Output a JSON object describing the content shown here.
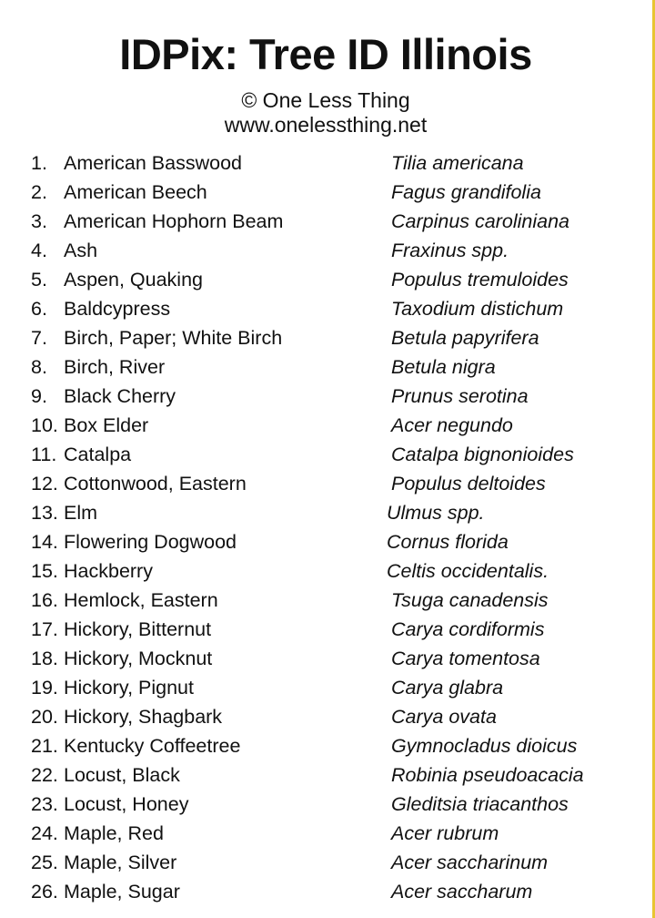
{
  "header": {
    "title": "IDPix: Tree ID Illinois",
    "copyright": "© One Less Thing",
    "website": "www.onelessthing.net"
  },
  "colors": {
    "accent_line": "#e8c532",
    "text": "#111111",
    "background": "#ffffff"
  },
  "trees": [
    {
      "num": "1.",
      "common": "American Basswood",
      "scientific": "Tilia americana"
    },
    {
      "num": "2.",
      "common": "American Beech",
      "scientific": "Fagus grandifolia"
    },
    {
      "num": "3.",
      "common": "American Hophorn Beam",
      "scientific": "Carpinus caroliniana"
    },
    {
      "num": "4.",
      "common": "Ash",
      "scientific": "Fraxinus spp."
    },
    {
      "num": "5.",
      "common": "Aspen, Quaking",
      "scientific": "Populus tremuloides"
    },
    {
      "num": "6.",
      "common": "Baldcypress",
      "scientific": "Taxodium distichum"
    },
    {
      "num": "7.",
      "common": "Birch, Paper; White Birch",
      "scientific": "Betula papyrifera"
    },
    {
      "num": "8.",
      "common": "Birch, River",
      "scientific": "Betula nigra"
    },
    {
      "num": "9.",
      "common": "Black Cherry",
      "scientific": "Prunus serotina"
    },
    {
      "num": "10.",
      "common": "Box Elder",
      "scientific": "Acer negundo"
    },
    {
      "num": "11.",
      "common": "Catalpa",
      "scientific": "Catalpa bignonioides"
    },
    {
      "num": "12.",
      "common": "Cottonwood, Eastern",
      "scientific": "Populus deltoides"
    },
    {
      "num": "13.",
      "common": "Elm",
      "scientific": "Ulmus spp."
    },
    {
      "num": "14.",
      "common": "Flowering Dogwood",
      "scientific": "Cornus florida"
    },
    {
      "num": "15.",
      "common": "Hackberry",
      "scientific": "Celtis occidentalis."
    },
    {
      "num": "16.",
      "common": "Hemlock, Eastern",
      "scientific": "Tsuga canadensis"
    },
    {
      "num": "17.",
      "common": "Hickory, Bitternut",
      "scientific": "Carya cordiformis"
    },
    {
      "num": "18.",
      "common": "Hickory, Mocknut",
      "scientific": "Carya tomentosa"
    },
    {
      "num": "19.",
      "common": "Hickory, Pignut",
      "scientific": "Carya glabra"
    },
    {
      "num": "20.",
      "common": "Hickory, Shagbark",
      "scientific": "Carya ovata"
    },
    {
      "num": "21.",
      "common": "Kentucky Coffeetree",
      "scientific": "Gymnocladus dioicus"
    },
    {
      "num": "22.",
      "common": "Locust, Black",
      "scientific": "Robinia pseudoacacia"
    },
    {
      "num": "23.",
      "common": "Locust, Honey",
      "scientific": "Gleditsia triacanthos"
    },
    {
      "num": "24.",
      "common": "Maple, Red",
      "scientific": "Acer rubrum"
    },
    {
      "num": "25.",
      "common": "Maple, Silver",
      "scientific": "Acer saccharinum"
    },
    {
      "num": "26.",
      "common": "Maple, Sugar",
      "scientific": "Acer saccharum"
    }
  ]
}
